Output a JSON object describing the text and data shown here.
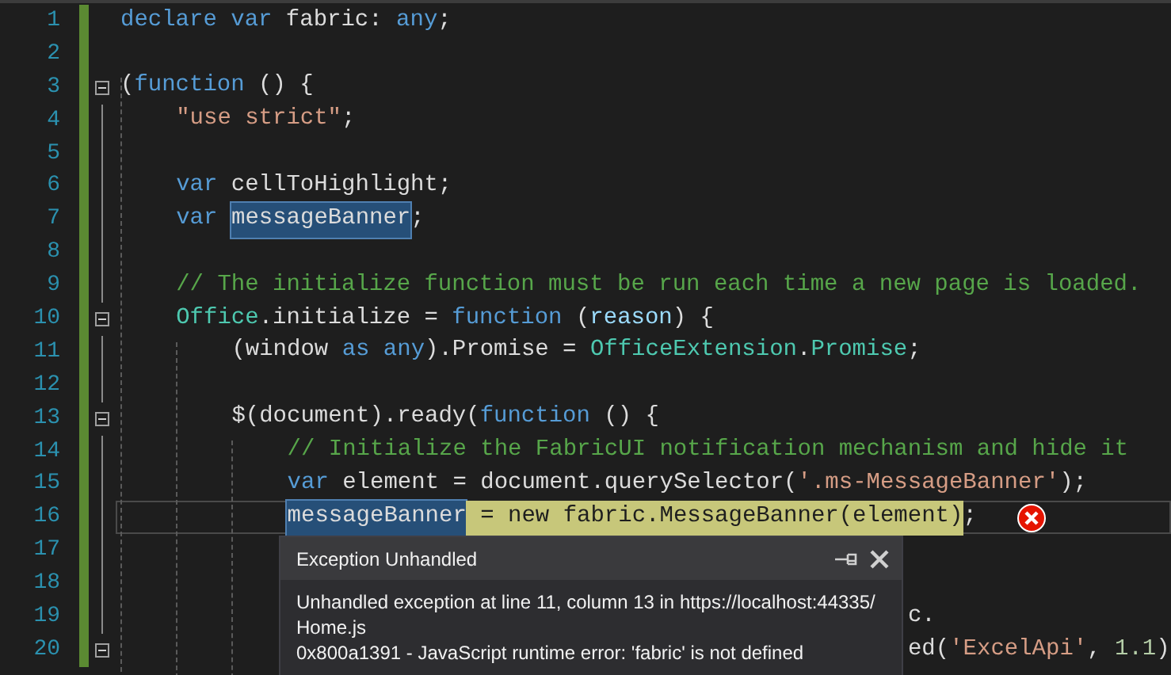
{
  "editor": {
    "lines": [
      {
        "number": "1",
        "fold": false,
        "current": false,
        "tokens": [
          {
            "kind": "keyword",
            "text": "declare var"
          },
          {
            "kind": "plain",
            "text": " fabric: "
          },
          {
            "kind": "keyword",
            "text": "any"
          },
          {
            "kind": "plain",
            "text": ";"
          }
        ]
      },
      {
        "number": "2",
        "fold": false,
        "current": false
      },
      {
        "number": "3",
        "fold": true,
        "current": false,
        "tokens": [
          {
            "kind": "plain",
            "text": "("
          },
          {
            "kind": "keyword",
            "text": "function"
          },
          {
            "kind": "plain",
            "text": " () {"
          }
        ],
        "children": [
          {
            "number": "4",
            "fold": false,
            "current": false,
            "tokens": [
              {
                "kind": "string",
                "text": "\"use strict\""
              },
              {
                "kind": "plain",
                "text": ";"
              }
            ]
          },
          {
            "number": "5",
            "fold": false,
            "current": false
          },
          {
            "number": "6",
            "fold": false,
            "current": false,
            "tokens": [
              {
                "kind": "keyword",
                "text": "var"
              },
              {
                "kind": "plain",
                "text": " cellToHighlight;"
              }
            ]
          },
          {
            "number": "7",
            "fold": false,
            "current": false,
            "tokens": [
              {
                "kind": "keyword",
                "text": "var"
              },
              {
                "kind": "selection",
                "text": "messageBanner"
              },
              {
                "kind": "plain",
                "text": ";"
              }
            ]
          },
          {
            "number": "8",
            "fold": false,
            "current": false
          },
          {
            "number": "9",
            "fold": false,
            "current": false,
            "tokens": [
              {
                "kind": "comment",
                "text": "// The initialize function must be run each time a new page is loaded."
              }
            ]
          },
          {
            "number": "10",
            "fold": true,
            "current": false,
            "tokens": [
              {
                "kind": "type",
                "text": "Office"
              },
              {
                "kind": "plain",
                "text": ".initialize = "
              },
              {
                "kind": "keyword",
                "text": "function"
              },
              {
                "kind": "plain",
                "text": " ("
              },
              {
                "kind": "param",
                "text": "reason"
              },
              {
                "kind": "plain",
                "text": ") {"
              }
            ],
            "children": [
              {
                "number": "11",
                "fold": false,
                "current": false,
                "tokens": [
                  {
                    "kind": "plain",
                    "text": "(window "
                  },
                  {
                    "kind": "keyword",
                    "text": "as any"
                  },
                  {
                    "kind": "plain",
                    "text": ").Promise = "
                  },
                  {
                    "kind": "type",
                    "text": "OfficeExtension"
                  },
                  {
                    "kind": "plain",
                    "text": "."
                  },
                  {
                    "kind": "type",
                    "text": "Promise"
                  },
                  {
                    "kind": "plain",
                    "text": ";"
                  }
                ]
              },
              {
                "number": "12",
                "fold": false,
                "current": false
              },
              {
                "number": "13",
                "fold": true,
                "current": false,
                "tokens": [
                  {
                    "kind": "plain",
                    "text": "$(document).ready("
                  },
                  {
                    "kind": "keyword",
                    "text": "function"
                  },
                  {
                    "kind": "plain",
                    "text": " () {"
                  }
                ],
                "children": [
                  {
                    "number": "14",
                    "fold": false,
                    "current": false,
                    "tokens": [
                      {
                        "kind": "comment",
                        "text": "// Initialize the FabricUI notification mechanism and hide it"
                      }
                    ]
                  },
                  {
                    "number": "15",
                    "fold": false,
                    "current": false,
                    "tokens": [
                      {
                        "kind": "keyword",
                        "text": "var"
                      },
                      {
                        "kind": "plain",
                        "text": " element = document.querySelector("
                      },
                      {
                        "kind": "string",
                        "text": "'.ms-MessageBanner'"
                      },
                      {
                        "kind": "plain",
                        "text": ");"
                      }
                    ]
                  },
                  {
                    "number": "16",
                    "fold": false,
                    "current": true,
                    "tokens": [
                      {
                        "kind": "selection",
                        "text": "messageBanner"
                      },
                      {
                        "kind": "statement",
                        "text": " = new fabric.MessageBanner(element)"
                      },
                      {
                        "kind": "plain",
                        "text": ";"
                      },
                      {
                        "kind": "error"
                      }
                    ]
                  },
                  {
                    "number": "17",
                    "fold": false,
                    "current": false
                  },
                  {
                    "number": "18",
                    "fold": false,
                    "current": false
                  },
                  {
                    "number": "19",
                    "fold": false,
                    "current": false,
                    "tokens": [
                      {
                        "kind": "hidden"
                      },
                      {
                        "kind": "plain",
                        "text": "c."
                      }
                    ]
                  },
                  {
                    "number": "20",
                    "fold": true,
                    "current": false,
                    "tokens": [
                      {
                        "kind": "hidden"
                      },
                      {
                        "kind": "plain",
                        "text": "ed("
                      },
                      {
                        "kind": "string",
                        "text": "'ExcelApi'"
                      },
                      {
                        "kind": "plain",
                        "text": ", "
                      },
                      {
                        "kind": "number",
                        "text": "1.1"
                      },
                      {
                        "kind": "plain",
                        "text": ")"
                      }
                    ]
                  }
                ]
              }
            ]
          }
        ]
      }
    ]
  },
  "exception_popup": {
    "title": "Exception Unhandled",
    "message_lines": [
      "Unhandled exception at line 11, column 13 in https://localhost:44335/",
      "Home.js",
      "0x800a1391 - JavaScript runtime error: 'fabric' is not defined"
    ]
  }
}
